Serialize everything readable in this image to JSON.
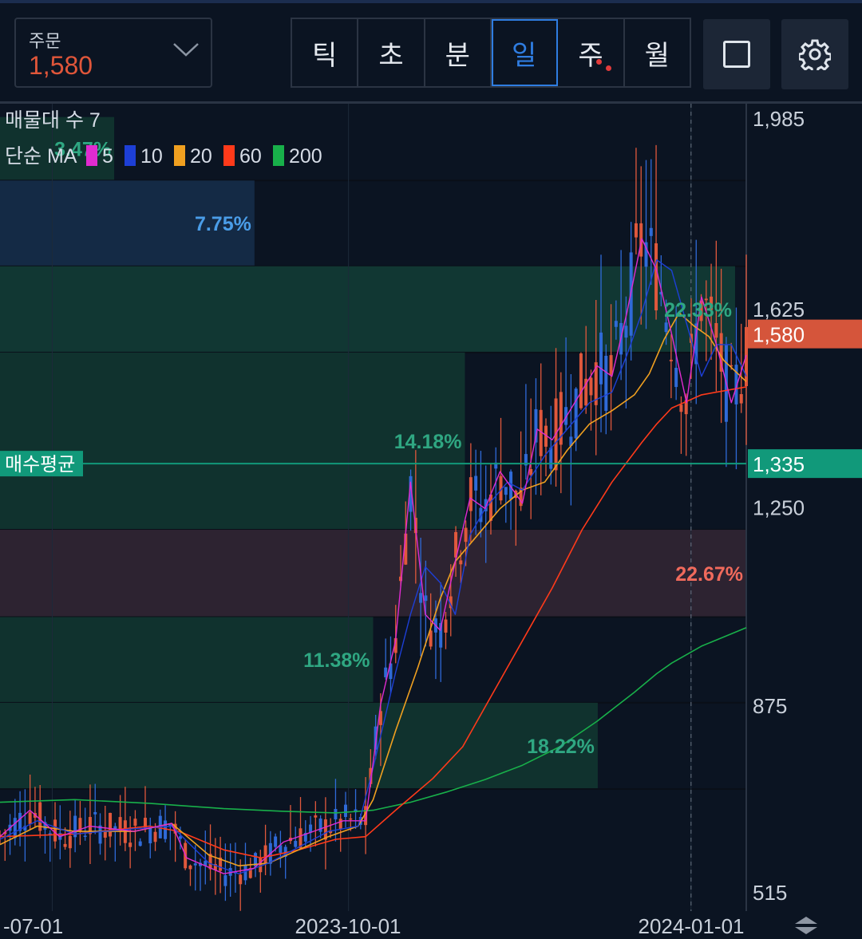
{
  "header": {
    "order_label": "주문",
    "order_value": "1,580",
    "timeframes": [
      "틱",
      "초",
      "분",
      "일",
      "주",
      "월"
    ],
    "active_timeframe": "일",
    "square_icon": "square-icon",
    "settings_icon": "gear-icon"
  },
  "chart_data": {
    "type": "candlestick",
    "title": "",
    "price_axis_ticks": [
      "1,985",
      "1,625",
      "1,250",
      "875",
      "515"
    ],
    "x_axis_ticks": [
      "-07-01",
      "2023-10-01",
      "2024-01-01"
    ],
    "volume_profile_label": "매물대 수 7",
    "ma_legend": {
      "prefix": "단순 MA",
      "items": [
        {
          "period": "5",
          "color": "#e02bd0"
        },
        {
          "period": "10",
          "color": "#1d3fd6"
        },
        {
          "period": "20",
          "color": "#f0a020"
        },
        {
          "period": "60",
          "color": "#ff3a1a"
        },
        {
          "period": "200",
          "color": "#18b04a"
        }
      ]
    },
    "current_price": {
      "label": "1,580",
      "value": 1580,
      "color": "#d5553b"
    },
    "avg_buy_price": {
      "label": "매수평균",
      "price_label": "1,335",
      "value": 1335,
      "color": "#11997a"
    },
    "volume_profile": [
      {
        "from": 1870,
        "to": 1990,
        "percent": "3.47%",
        "color": "#10322e",
        "text_color": "#2fa782",
        "width_frac": 0.153
      },
      {
        "from": 1708,
        "to": 1870,
        "percent": "7.75%",
        "color": "#142a45",
        "text_color": "#4a9de8",
        "width_frac": 0.341
      },
      {
        "from": 1545,
        "to": 1708,
        "percent": "22.33%",
        "color": "#113733",
        "text_color": "#2fa782",
        "width_frac": 0.985
      },
      {
        "from": 1210,
        "to": 1545,
        "percent": "14.18%",
        "color": "#10322e",
        "text_color": "#2fa782",
        "width_frac": 0.623
      },
      {
        "from": 1045,
        "to": 1210,
        "percent": "22.67%",
        "color": "#2d2331",
        "text_color": "#f06a5c",
        "width_frac": 1.0
      },
      {
        "from": 883,
        "to": 1045,
        "percent": "11.38%",
        "color": "#10322e",
        "text_color": "#2fa782",
        "width_frac": 0.5
      },
      {
        "from": 720,
        "to": 883,
        "percent": "18.22%",
        "color": "#10322e",
        "text_color": "#2fa782",
        "width_frac": 0.801
      }
    ],
    "y_range": [
      515,
      1985
    ],
    "x_range_dates": [
      "2023-06-10",
      "2024-01-25"
    ],
    "ma200": [
      [
        0,
        695
      ],
      [
        0.1,
        700
      ],
      [
        0.2,
        693
      ],
      [
        0.3,
        683
      ],
      [
        0.38,
        678
      ],
      [
        0.45,
        675
      ],
      [
        0.5,
        680
      ],
      [
        0.55,
        695
      ],
      [
        0.6,
        715
      ],
      [
        0.65,
        738
      ],
      [
        0.7,
        765
      ],
      [
        0.75,
        800
      ],
      [
        0.8,
        848
      ],
      [
        0.85,
        903
      ],
      [
        0.88,
        938
      ],
      [
        0.9,
        958
      ],
      [
        0.94,
        990
      ],
      [
        1.0,
        1025
      ]
    ],
    "ma60": [
      [
        0,
        630
      ],
      [
        0.1,
        635
      ],
      [
        0.2,
        650
      ],
      [
        0.24,
        640
      ],
      [
        0.3,
        605
      ],
      [
        0.35,
        590
      ],
      [
        0.4,
        605
      ],
      [
        0.45,
        625
      ],
      [
        0.49,
        630
      ],
      [
        0.53,
        680
      ],
      [
        0.58,
        740
      ],
      [
        0.62,
        800
      ],
      [
        0.66,
        900
      ],
      [
        0.7,
        1000
      ],
      [
        0.74,
        1100
      ],
      [
        0.78,
        1210
      ],
      [
        0.82,
        1300
      ],
      [
        0.86,
        1375
      ],
      [
        0.88,
        1410
      ],
      [
        0.9,
        1440
      ],
      [
        0.94,
        1465
      ],
      [
        1.0,
        1480
      ]
    ],
    "ma20": [
      [
        0,
        615
      ],
      [
        0.05,
        650
      ],
      [
        0.1,
        640
      ],
      [
        0.18,
        640
      ],
      [
        0.23,
        655
      ],
      [
        0.28,
        595
      ],
      [
        0.32,
        575
      ],
      [
        0.36,
        580
      ],
      [
        0.4,
        605
      ],
      [
        0.44,
        630
      ],
      [
        0.48,
        650
      ],
      [
        0.5,
        700
      ],
      [
        0.53,
        830
      ],
      [
        0.56,
        950
      ],
      [
        0.59,
        1080
      ],
      [
        0.61,
        1150
      ],
      [
        0.64,
        1200
      ],
      [
        0.67,
        1250
      ],
      [
        0.7,
        1285
      ],
      [
        0.73,
        1300
      ],
      [
        0.76,
        1360
      ],
      [
        0.79,
        1410
      ],
      [
        0.82,
        1435
      ],
      [
        0.85,
        1465
      ],
      [
        0.87,
        1505
      ],
      [
        0.89,
        1570
      ],
      [
        0.91,
        1620
      ],
      [
        0.93,
        1595
      ],
      [
        0.95,
        1575
      ],
      [
        0.97,
        1530
      ],
      [
        1.0,
        1490
      ]
    ],
    "ma10": [
      [
        0,
        625
      ],
      [
        0.05,
        660
      ],
      [
        0.1,
        635
      ],
      [
        0.18,
        645
      ],
      [
        0.23,
        650
      ],
      [
        0.28,
        580
      ],
      [
        0.32,
        560
      ],
      [
        0.36,
        580
      ],
      [
        0.4,
        610
      ],
      [
        0.44,
        640
      ],
      [
        0.48,
        650
      ],
      [
        0.5,
        760
      ],
      [
        0.53,
        940
      ],
      [
        0.55,
        1050
      ],
      [
        0.57,
        1140
      ],
      [
        0.59,
        1110
      ],
      [
        0.61,
        1050
      ],
      [
        0.63,
        1200
      ],
      [
        0.65,
        1250
      ],
      [
        0.68,
        1300
      ],
      [
        0.7,
        1285
      ],
      [
        0.73,
        1350
      ],
      [
        0.76,
        1400
      ],
      [
        0.79,
        1450
      ],
      [
        0.82,
        1470
      ],
      [
        0.84,
        1540
      ],
      [
        0.86,
        1620
      ],
      [
        0.88,
        1720
      ],
      [
        0.9,
        1700
      ],
      [
        0.92,
        1600
      ],
      [
        0.94,
        1500
      ],
      [
        0.96,
        1560
      ],
      [
        0.98,
        1560
      ],
      [
        1.0,
        1500
      ]
    ],
    "ma5": [
      [
        0,
        630
      ],
      [
        0.04,
        680
      ],
      [
        0.08,
        630
      ],
      [
        0.12,
        650
      ],
      [
        0.18,
        640
      ],
      [
        0.23,
        655
      ],
      [
        0.25,
        590
      ],
      [
        0.3,
        560
      ],
      [
        0.34,
        570
      ],
      [
        0.38,
        620
      ],
      [
        0.42,
        640
      ],
      [
        0.46,
        660
      ],
      [
        0.49,
        660
      ],
      [
        0.51,
        880
      ],
      [
        0.53,
        1000
      ],
      [
        0.55,
        1300
      ],
      [
        0.57,
        1050
      ],
      [
        0.59,
        1020
      ],
      [
        0.61,
        1150
      ],
      [
        0.63,
        1270
      ],
      [
        0.65,
        1250
      ],
      [
        0.67,
        1320
      ],
      [
        0.7,
        1260
      ],
      [
        0.72,
        1400
      ],
      [
        0.74,
        1380
      ],
      [
        0.77,
        1450
      ],
      [
        0.8,
        1520
      ],
      [
        0.82,
        1500
      ],
      [
        0.84,
        1620
      ],
      [
        0.86,
        1760
      ],
      [
        0.88,
        1700
      ],
      [
        0.9,
        1580
      ],
      [
        0.92,
        1450
      ],
      [
        0.94,
        1650
      ],
      [
        0.96,
        1560
      ],
      [
        0.98,
        1450
      ],
      [
        1.0,
        1540
      ]
    ]
  },
  "scroll_icon": "scroll-handle-icon"
}
